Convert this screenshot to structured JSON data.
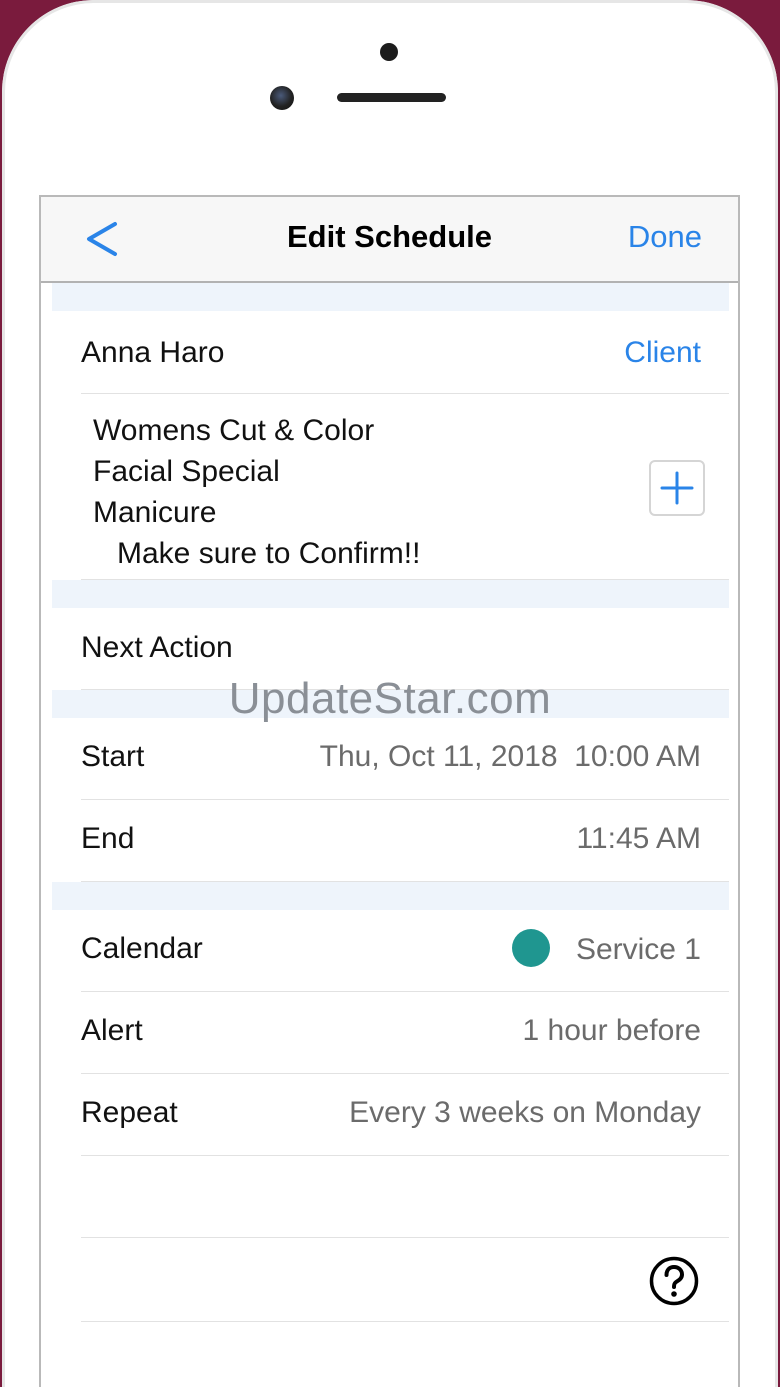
{
  "navbar": {
    "back_icon": "chevron-left-icon",
    "title": "Edit Schedule",
    "done_label": "Done"
  },
  "client": {
    "name": "Anna Haro",
    "link_label": "Client"
  },
  "services": {
    "items": [
      "Womens Cut & Color",
      "Facial Special",
      "Manicure"
    ],
    "note": "Make sure to Confirm!!",
    "add_icon": "plus-icon"
  },
  "next_action": {
    "label": "Next Action"
  },
  "start": {
    "label": "Start",
    "date": "Thu, Oct 11, 2018",
    "time": "10:00 AM"
  },
  "end": {
    "label": "End",
    "time": "11:45 AM"
  },
  "calendar": {
    "label": "Calendar",
    "value": "Service 1",
    "color": "#1f9690"
  },
  "alert": {
    "label": "Alert",
    "value": "1 hour before"
  },
  "repeat": {
    "label": "Repeat",
    "value": "Every 3 weeks on Monday"
  },
  "help_icon": "question-circle-icon",
  "watermark": "UpdateStar.com",
  "colors": {
    "accent": "#2a84e8",
    "background": "#7a1b3d",
    "section_spacer": "#eef4fb"
  }
}
